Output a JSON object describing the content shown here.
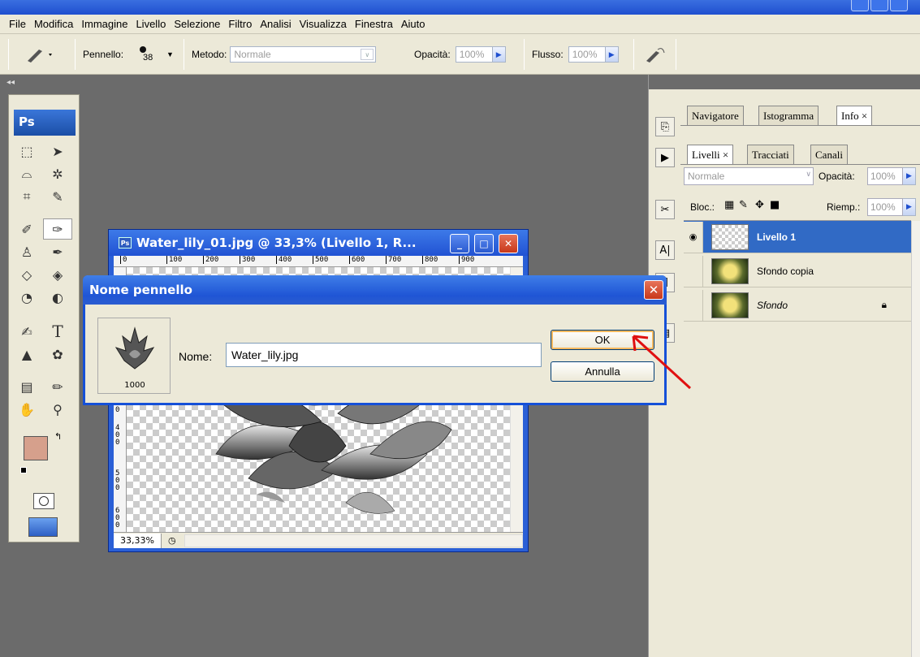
{
  "menubar": {
    "items": [
      "File",
      "Modifica",
      "Immagine",
      "Livello",
      "Selezione",
      "Filtro",
      "Analisi",
      "Visualizza",
      "Finestra",
      "Aiuto"
    ]
  },
  "options": {
    "brush_label": "Pennello:",
    "brush_size": "38",
    "method_label": "Metodo:",
    "method_value": "Normale",
    "opacity_label": "Opacità:",
    "opacity_value": "100%",
    "flow_label": "Flusso:",
    "flow_value": "100%"
  },
  "toolbox": {
    "logo": "Ps"
  },
  "document": {
    "title": "Water_lily_01.jpg @ 33,3% (Livello 1, R...",
    "ruler_ticks": [
      "0",
      "100",
      "200",
      "300",
      "400",
      "500",
      "600",
      "700",
      "800",
      "900"
    ],
    "vruler_ticks": [
      "0",
      "400",
      "500",
      "600"
    ],
    "zoom": "33,33%"
  },
  "navigator_panel": {
    "tabs": [
      "Navigatore",
      "Istogramma",
      "Info ×"
    ]
  },
  "layers_panel": {
    "tabs": [
      "Livelli ×",
      "Tracciati",
      "Canali"
    ],
    "blend_mode": "Normale",
    "opacity_label": "Opacità:",
    "opacity_value": "100%",
    "lock_label": "Bloc.:",
    "fill_label": "Riemp.:",
    "fill_value": "100%",
    "layers": [
      {
        "name": "Livello 1",
        "selected": true
      },
      {
        "name": "Sfondo copia",
        "selected": false
      },
      {
        "name": "Sfondo",
        "selected": false
      }
    ]
  },
  "dialog": {
    "title": "Nome pennello",
    "preview_number": "1000",
    "name_label": "Nome:",
    "name_value": "Water_lily.jpg",
    "ok_label": "OK",
    "cancel_label": "Annulla"
  },
  "colors": {
    "foreground": "#d6a08c",
    "background": "#ffffff",
    "selection_blue": "#316ac5",
    "annotation_red": "#e01010"
  }
}
